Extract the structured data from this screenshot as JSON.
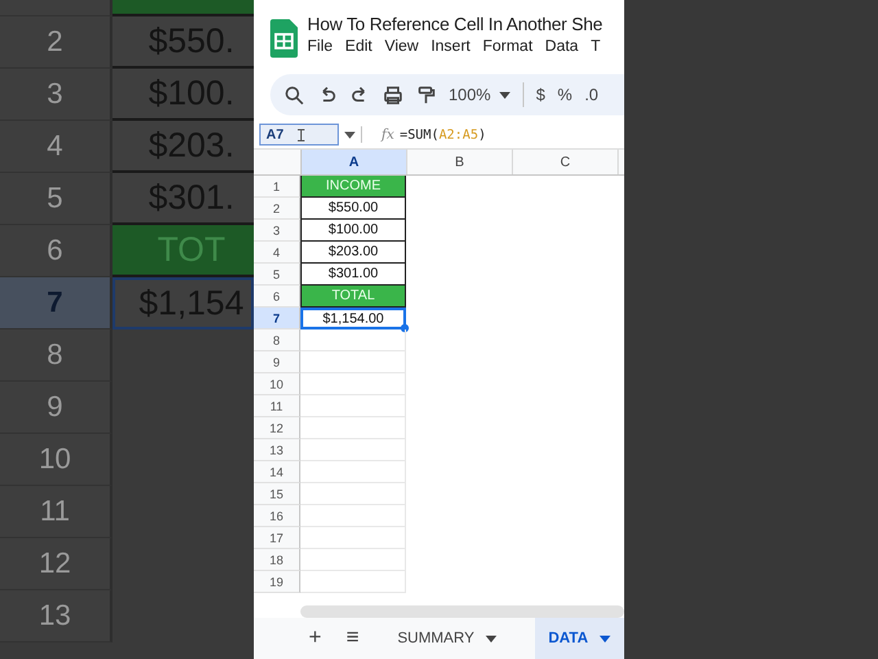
{
  "background_zoom": {
    "rows": [
      {
        "number": "",
        "value": "",
        "kind": "label",
        "selected": false
      },
      {
        "number": "2",
        "value": "$550.",
        "kind": "value",
        "selected": false
      },
      {
        "number": "3",
        "value": "$100.",
        "kind": "value",
        "selected": false
      },
      {
        "number": "4",
        "value": "$203.",
        "kind": "value",
        "selected": false
      },
      {
        "number": "5",
        "value": "$301.",
        "kind": "value",
        "selected": false
      },
      {
        "number": "6",
        "value": "TOT",
        "kind": "label",
        "selected": false
      },
      {
        "number": "7",
        "value": "$1,154",
        "kind": "value",
        "selected": true
      },
      {
        "number": "8",
        "value": "",
        "kind": "empty",
        "selected": false
      },
      {
        "number": "9",
        "value": "",
        "kind": "empty",
        "selected": false
      },
      {
        "number": "10",
        "value": "",
        "kind": "empty",
        "selected": false
      },
      {
        "number": "11",
        "value": "",
        "kind": "empty",
        "selected": false
      },
      {
        "number": "12",
        "value": "",
        "kind": "empty",
        "selected": false
      },
      {
        "number": "13",
        "value": "",
        "kind": "empty",
        "selected": false
      }
    ]
  },
  "app": {
    "title": "How To Reference Cell In Another She",
    "menu": [
      "File",
      "Edit",
      "View",
      "Insert",
      "Format",
      "Data",
      "T"
    ],
    "toolbar": {
      "zoom": "100%",
      "currency": "$",
      "percent": "%",
      "decimal": ".0"
    },
    "name_box": "A7",
    "formula": {
      "fx": "fx",
      "prefix": "=SUM(",
      "range": "A2:A5",
      "suffix": ")"
    },
    "columns": [
      {
        "label": "A",
        "selected": true
      },
      {
        "label": "B",
        "selected": false
      },
      {
        "label": "C",
        "selected": false
      }
    ],
    "rows": [
      {
        "number": "1",
        "value": "INCOME",
        "kind": "label",
        "selected": false
      },
      {
        "number": "2",
        "value": "$550.00",
        "kind": "value",
        "selected": false
      },
      {
        "number": "3",
        "value": "$100.00",
        "kind": "value",
        "selected": false
      },
      {
        "number": "4",
        "value": "$203.00",
        "kind": "value",
        "selected": false
      },
      {
        "number": "5",
        "value": "$301.00",
        "kind": "value",
        "selected": false
      },
      {
        "number": "6",
        "value": "TOTAL",
        "kind": "label",
        "selected": false
      },
      {
        "number": "7",
        "value": "$1,154.00",
        "kind": "value",
        "selected": true
      },
      {
        "number": "8",
        "kind": "empty",
        "selected": false
      },
      {
        "number": "9",
        "kind": "empty",
        "selected": false
      },
      {
        "number": "10",
        "kind": "empty",
        "selected": false
      },
      {
        "number": "11",
        "kind": "empty",
        "selected": false
      },
      {
        "number": "12",
        "kind": "empty",
        "selected": false
      },
      {
        "number": "13",
        "kind": "empty",
        "selected": false
      },
      {
        "number": "14",
        "kind": "empty",
        "selected": false
      },
      {
        "number": "15",
        "kind": "empty",
        "selected": false
      },
      {
        "number": "16",
        "kind": "empty",
        "selected": false
      },
      {
        "number": "17",
        "kind": "empty",
        "selected": false
      },
      {
        "number": "18",
        "kind": "empty",
        "selected": false
      },
      {
        "number": "19",
        "kind": "empty",
        "selected": false
      }
    ],
    "sheet_bar": {
      "add": "+",
      "list": "≡"
    },
    "sheets": [
      {
        "label": "SUMMARY",
        "selected": false
      },
      {
        "label": "DATA",
        "selected": true
      }
    ]
  }
}
